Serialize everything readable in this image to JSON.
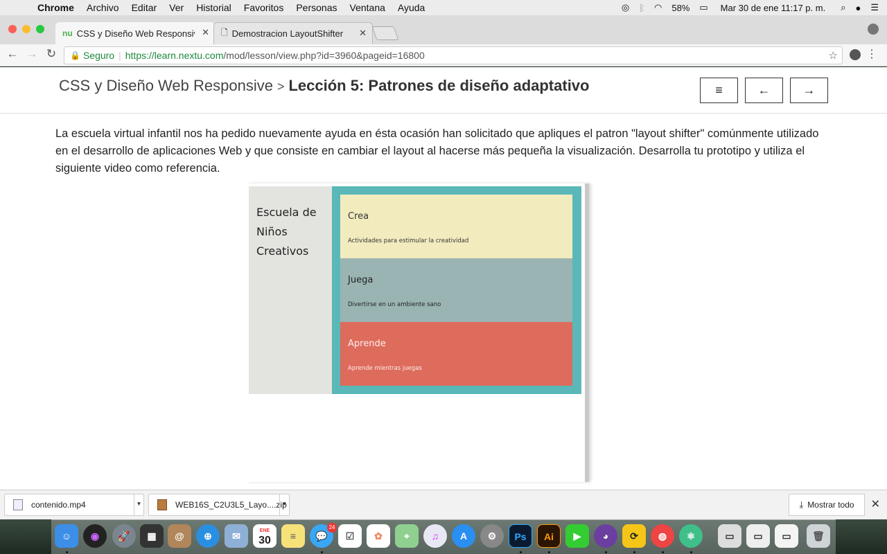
{
  "menubar": {
    "app": "Chrome",
    "items": [
      "Archivo",
      "Editar",
      "Ver",
      "Historial",
      "Favoritos",
      "Personas",
      "Ventana",
      "Ayuda"
    ],
    "battery": "58%",
    "datetime": "Mar 30 de ene  11:17 p. m."
  },
  "tabs": [
    {
      "title": "CSS y Diseño Web Responsive",
      "icon": "nu-logo-icon",
      "active": true
    },
    {
      "title": "Demostracion LayoutShifter",
      "icon": "page-icon",
      "active": false
    }
  ],
  "toolbar": {
    "secure_label": "Seguro",
    "url_host": "https://learn.nextu.com",
    "url_path": "/mod/lesson/view.php?id=3960&pageid=16800"
  },
  "page": {
    "breadcrumb_course": "CSS y Diseño Web Responsive",
    "breadcrumb_sep": ">",
    "breadcrumb_lesson": "Lección 5: Patrones de diseño adaptativo",
    "buttons": {
      "menu": "≡",
      "prev": "←",
      "next": "→"
    },
    "paragraph": "La escuela virtual infantil nos ha pedido nuevamente ayuda en ésta ocasión han solicitado que apliques el patron \"layout shifter\" comúnmente utilizado en el desarrollo de aplicaciones Web y que consiste en cambiar el layout al hacerse más pequeña la visualización. Desarrolla tu prototipo y utiliza el siguiente video como referencia."
  },
  "video": {
    "sidebar_title": "Escuela de Niños Creativos",
    "cards": [
      {
        "title": "Crea",
        "desc": "Actividades para estimular la creatividad",
        "color": "#f2ebbe"
      },
      {
        "title": "Juega",
        "desc": "Divertirse en un ambiente sano",
        "color": "#99b4b3"
      },
      {
        "title": "Aprende",
        "desc": "Aprende mientras juegas",
        "color": "#dd6c5c"
      }
    ],
    "content_bg": "#5ab8b8"
  },
  "downloads": {
    "items": [
      {
        "name": "contenido.mp4"
      },
      {
        "name": "WEB16S_C2U3L5_Layo....zip"
      }
    ],
    "show_all": "Mostrar todo"
  },
  "dock": {
    "calendar_month": "ENE",
    "calendar_day": "30",
    "messages_badge": "24",
    "ps_label": "Ps",
    "ai_label": "Ai"
  }
}
